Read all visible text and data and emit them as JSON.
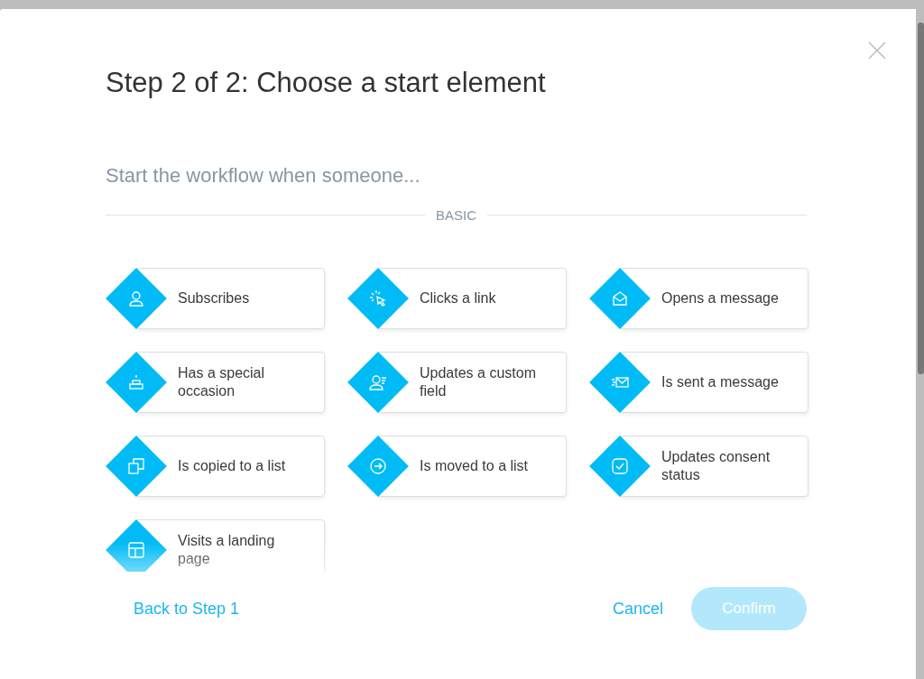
{
  "dialog": {
    "title": "Step 2 of 2: Choose a start element",
    "subtitle": "Start the workflow when someone...",
    "section": "BASIC",
    "options": [
      {
        "label": "Subscribes"
      },
      {
        "label": "Clicks a link"
      },
      {
        "label": "Opens a message"
      },
      {
        "label": "Has a special occasion"
      },
      {
        "label": "Updates a custom field"
      },
      {
        "label": "Is sent a message"
      },
      {
        "label": "Is copied to a list"
      },
      {
        "label": "Is moved to a list"
      },
      {
        "label": "Updates consent status"
      },
      {
        "label": "Visits a landing page"
      }
    ],
    "back_link": "Back to Step 1",
    "cancel_button": "Cancel",
    "confirm_button": {
      "label": "Confirm",
      "disabled": true
    }
  }
}
